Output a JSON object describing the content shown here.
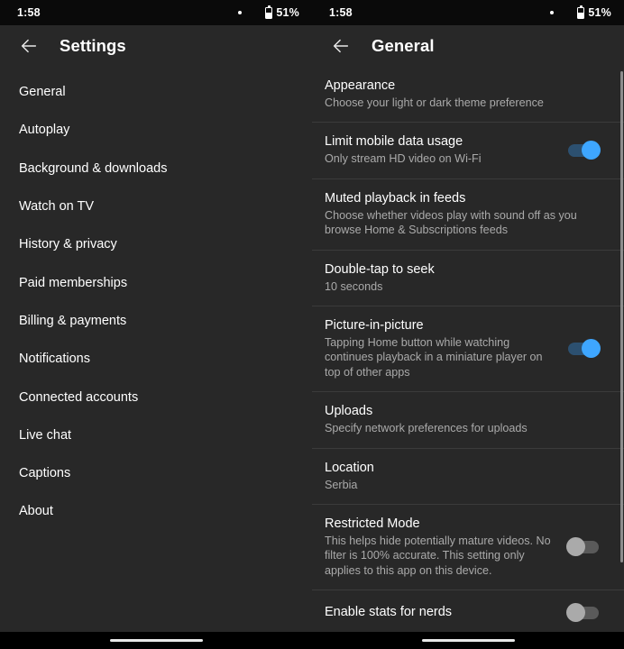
{
  "status_bar": {
    "time": "1:58",
    "notification_dot": "dot-icon",
    "battery_icon": "battery-icon",
    "battery_percent": "51%"
  },
  "left_pane": {
    "appbar": {
      "back_icon": "back-arrow-icon",
      "title": "Settings"
    },
    "items": [
      {
        "label": "General"
      },
      {
        "label": "Autoplay"
      },
      {
        "label": "Background & downloads"
      },
      {
        "label": "Watch on TV"
      },
      {
        "label": "History & privacy"
      },
      {
        "label": "Paid memberships"
      },
      {
        "label": "Billing & payments"
      },
      {
        "label": "Notifications"
      },
      {
        "label": "Connected accounts"
      },
      {
        "label": "Live chat"
      },
      {
        "label": "Captions"
      },
      {
        "label": "About"
      }
    ]
  },
  "right_pane": {
    "appbar": {
      "back_icon": "back-arrow-icon",
      "title": "General"
    },
    "rows": [
      {
        "title": "Appearance",
        "subtitle": "Choose your light or dark theme preference",
        "toggle": null,
        "divider": false
      },
      {
        "title": "Limit mobile data usage",
        "subtitle": "Only stream HD video on Wi-Fi",
        "toggle": "on",
        "divider": true
      },
      {
        "title": "Muted playback in feeds",
        "subtitle": "Choose whether videos play with sound off as you browse Home & Subscriptions feeds",
        "toggle": null,
        "divider": true
      },
      {
        "title": "Double-tap to seek",
        "subtitle": "10 seconds",
        "toggle": null,
        "divider": true
      },
      {
        "title": "Picture-in-picture",
        "subtitle": "Tapping Home button while watching continues playback in a miniature player on top of other apps",
        "toggle": "on",
        "divider": true
      },
      {
        "title": "Uploads",
        "subtitle": "Specify network preferences for uploads",
        "toggle": null,
        "divider": true
      },
      {
        "title": "Location",
        "subtitle": "Serbia",
        "toggle": null,
        "divider": true
      },
      {
        "title": "Restricted Mode",
        "subtitle": "This helps hide potentially mature videos. No filter is 100% accurate. This setting only applies to this app on this device.",
        "toggle": "off",
        "divider": true
      },
      {
        "title": "Enable stats for nerds",
        "subtitle": "",
        "toggle": "off",
        "divider": true
      }
    ]
  },
  "colors": {
    "background": "#282828",
    "status_bar": "#0a0a0a",
    "accent_on": "#3ea6ff",
    "toggle_off": "#aaaaaa",
    "divider": "#3b3b3b",
    "secondary_text": "#aaaaaa"
  }
}
